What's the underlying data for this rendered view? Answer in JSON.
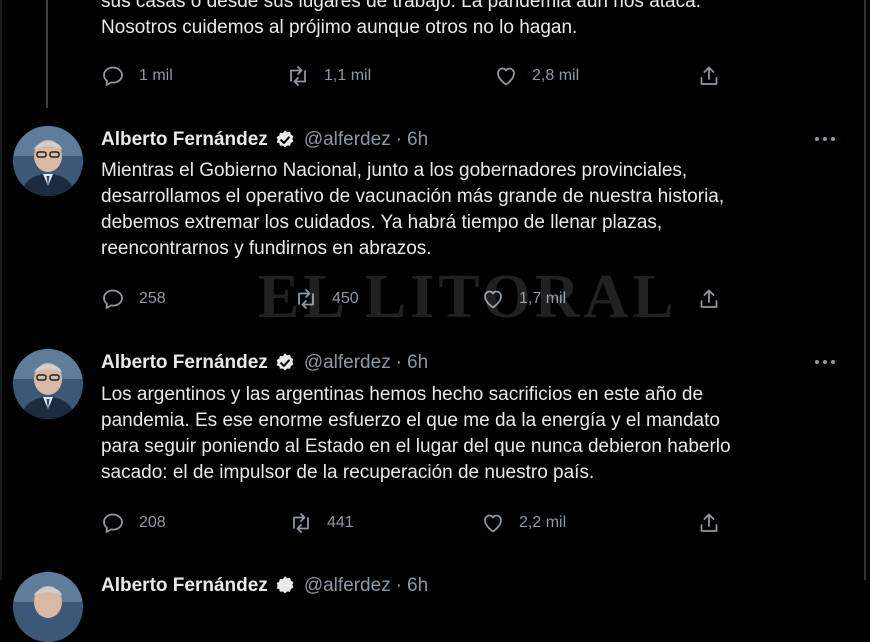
{
  "previous_tweet": {
    "text_lines": [
      "sus casas o desde sus lugares de trabajo. La pandemia aún nos ataca.",
      "Nosotros cuidemos al prójimo aunque otros no lo hagan."
    ],
    "replies": "1 mil",
    "retweets": "1,1 mil",
    "likes": "2,8 mil"
  },
  "tweets": [
    {
      "author_name": "Alberto Fernández",
      "handle": "@alferdez",
      "separator": "·",
      "time": "6h",
      "text_lines": [
        "Mientras el Gobierno Nacional, junto a los gobernadores provinciales,",
        "desarrollamos el operativo de vacunación más grande de nuestra historia,",
        "debemos extremar los cuidados. Ya habrá tiempo de llenar plazas,",
        "reencontrarnos y fundirnos en abrazos."
      ],
      "replies": "258",
      "retweets": "450",
      "likes": "1,7 mil"
    },
    {
      "author_name": "Alberto Fernández",
      "handle": "@alferdez",
      "separator": "·",
      "time": "6h",
      "text_lines": [
        "Los argentinos y las argentinas hemos hecho sacrificios en este año de",
        "pandemia. Es ese enorme esfuerzo el que me da la energía y el mandato",
        "para seguir poniendo al Estado en el lugar del que nunca debieron haberlo",
        "sacado: el de impulsor de la recuperación de nuestro país."
      ],
      "replies": "208",
      "retweets": "441",
      "likes": "2,2 mil"
    },
    {
      "author_name": "Alberto Fernández",
      "handle": "@alferdez",
      "separator": "·",
      "time": "6h"
    }
  ],
  "watermark": "EL LITORAL",
  "colors": {
    "background": "#000000",
    "text": "#e7e9ea",
    "muted": "#8b98a5",
    "verified": "#1d9bf0"
  },
  "icons": [
    "reply-icon",
    "retweet-icon",
    "like-icon",
    "share-icon",
    "verified-badge-icon",
    "more-options-icon"
  ]
}
